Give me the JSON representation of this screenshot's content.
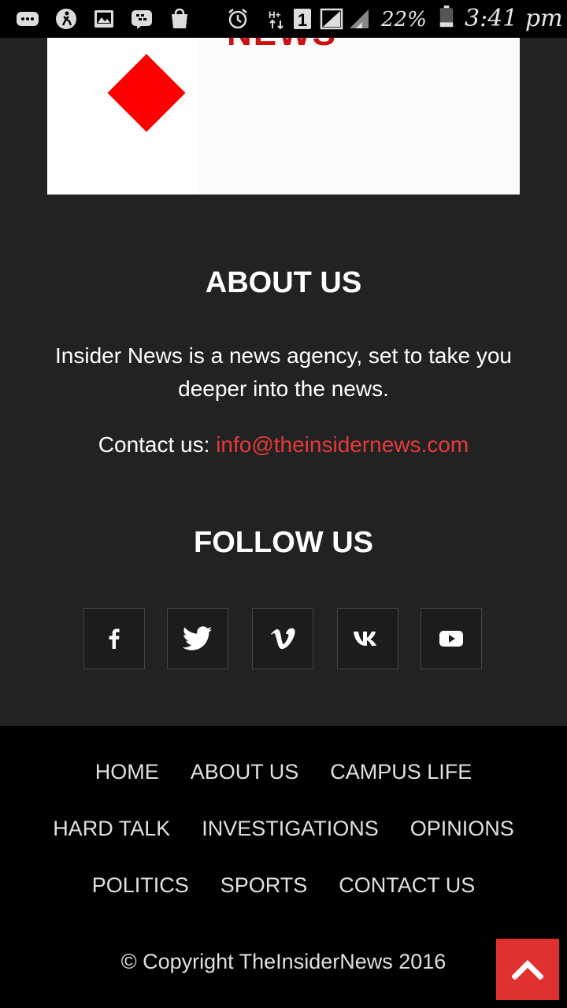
{
  "status_bar": {
    "battery_percent": "22%",
    "time": "3:41 pm",
    "sim_slot": "1",
    "network": "H+"
  },
  "banner": {
    "logo_text": "NEWS"
  },
  "about": {
    "title": "ABOUT US",
    "description": "Insider News is a news agency, set to take you deeper into the news.",
    "contact_label": "Contact us: ",
    "contact_email": "info@theinsidernews.com"
  },
  "follow": {
    "title": "FOLLOW US",
    "icons": [
      "facebook-icon",
      "twitter-icon",
      "vimeo-icon",
      "vk-icon",
      "youtube-icon"
    ]
  },
  "footer": {
    "nav_rows": [
      [
        "HOME",
        "ABOUT US",
        "CAMPUS LIFE"
      ],
      [
        "HARD TALK",
        "INVESTIGATIONS",
        "OPINIONS"
      ],
      [
        "POLITICS",
        "SPORTS",
        "CONTACT US"
      ]
    ],
    "copyright": "© Copyright TheInsiderNews 2016"
  },
  "colors": {
    "accent": "#e03030",
    "link": "#e63a3a",
    "background": "#222222",
    "footer_bg": "#000000"
  }
}
